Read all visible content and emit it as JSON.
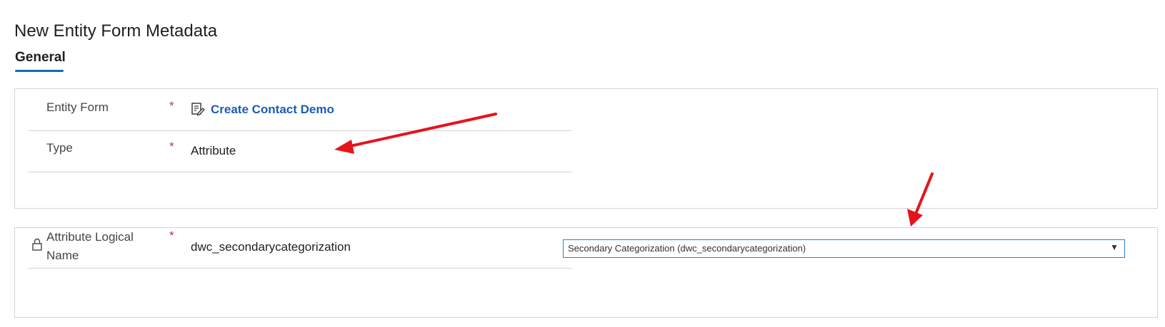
{
  "page": {
    "title": "New Entity Form Metadata"
  },
  "tabs": [
    {
      "label": "General",
      "active": true
    }
  ],
  "section_general": {
    "fields": [
      {
        "label": "Entity Form",
        "required_mark": "*",
        "value": "Create Contact Demo",
        "value_type": "lookup-link"
      },
      {
        "label": "Type",
        "required_mark": "*",
        "value": "Attribute"
      }
    ]
  },
  "section_attribute": {
    "field": {
      "label_line1": "Attribute Logical",
      "label_line2": "Name",
      "required_mark": "*",
      "value": "dwc_secondarycategorization",
      "locked": true
    },
    "dropdown": {
      "selected": "Secondary Categorization (dwc_secondarycategorization)",
      "arrow": "▼"
    }
  },
  "icons": {
    "lookup": "entity-lookup-icon",
    "lock": "lock-icon",
    "dropdown": "chevron-down-icon"
  },
  "colors": {
    "accent": "#0f6cbd",
    "link": "#1a5cb8",
    "required": "#c4314b",
    "annotation_arrow": "#e5141b",
    "border": "#d5d5d5",
    "dropdown_border": "#2b7fd8"
  }
}
